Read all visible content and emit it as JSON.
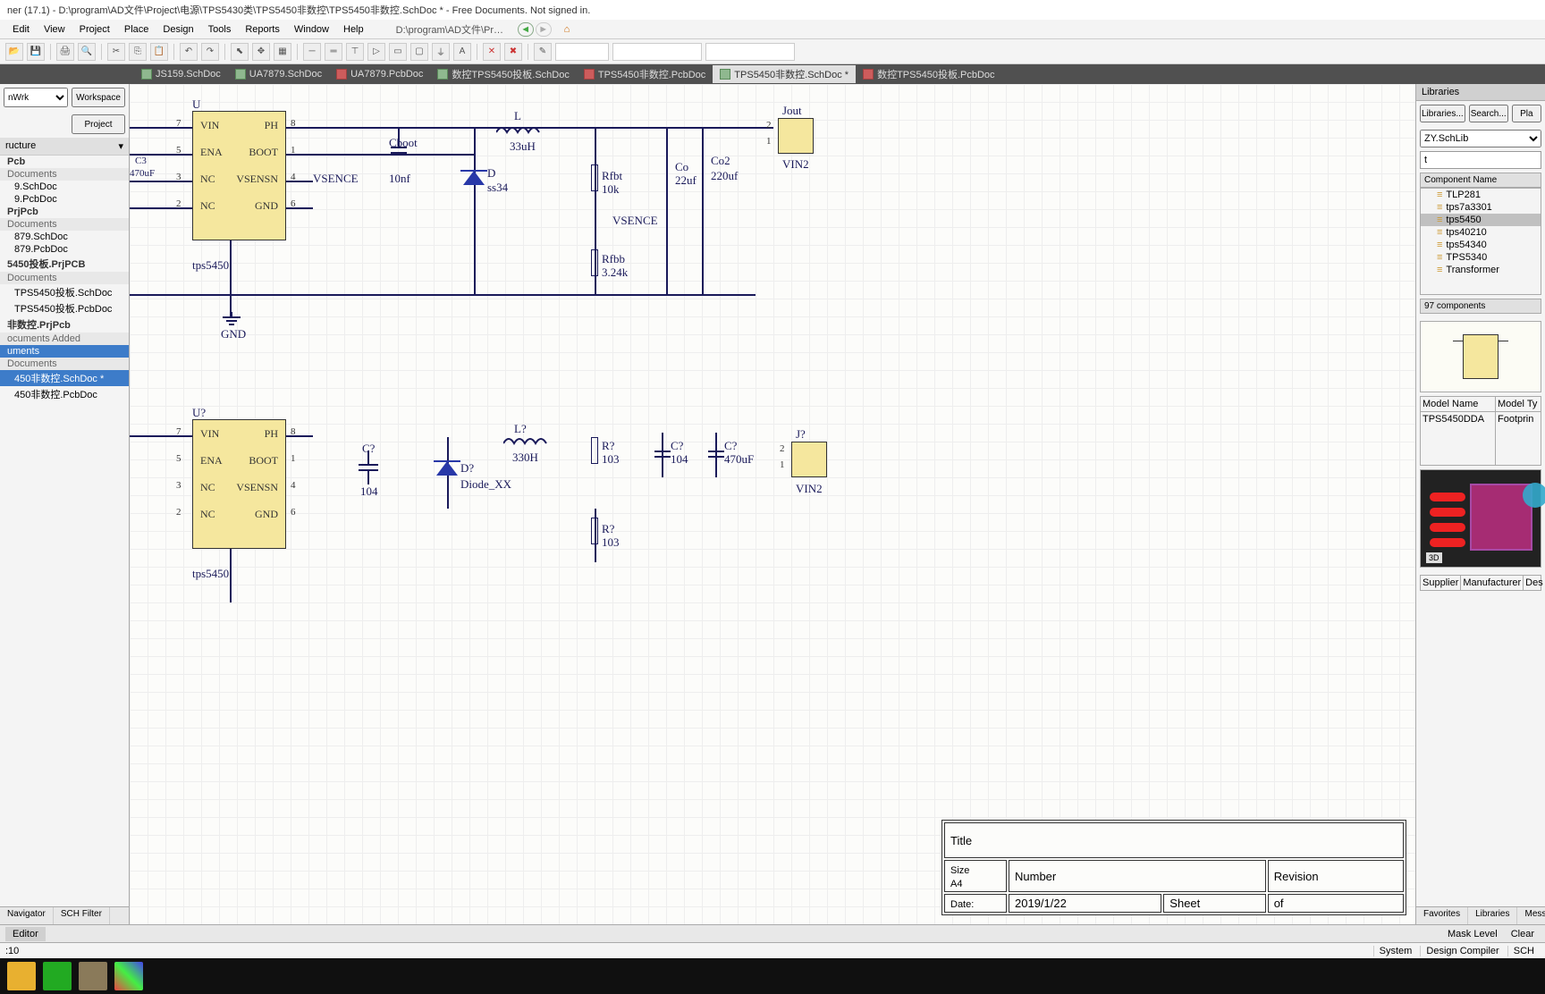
{
  "title": "ner (17.1) - D:\\program\\AD文件\\Project\\电源\\TPS5430类\\TPS5450非数控\\TPS5450非数控.SchDoc * - Free Documents. Not signed in.",
  "menu": [
    "Edit",
    "View",
    "Project",
    "Place",
    "Design",
    "Tools",
    "Reports",
    "Window",
    "Help"
  ],
  "addr": "D:\\program\\AD文件\\Project\\电…",
  "tabs": [
    {
      "name": "JS159.SchDoc",
      "type": "sch"
    },
    {
      "name": "UA7879.SchDoc",
      "type": "sch"
    },
    {
      "name": "UA7879.PcbDoc",
      "type": "pcb"
    },
    {
      "name": "数控TPS5450投板.SchDoc",
      "type": "sch"
    },
    {
      "name": "TPS5450非数控.PcbDoc",
      "type": "pcb"
    },
    {
      "name": "TPS5450非数控.SchDoc *",
      "type": "sch",
      "active": true
    },
    {
      "name": "数控TPS5450投板.PcbDoc",
      "type": "pcb"
    }
  ],
  "left": {
    "workspace_sel": "nWrk",
    "workspace_btn": "Workspace",
    "project_btn": "Project",
    "structure": "ructure",
    "tree": [
      {
        "t": "Pcb",
        "c": "proj"
      },
      {
        "t": "Documents",
        "c": "folder"
      },
      {
        "t": "9.SchDoc",
        "c": "file"
      },
      {
        "t": "9.PcbDoc",
        "c": "file"
      },
      {
        "t": "PrjPcb",
        "c": "proj"
      },
      {
        "t": "Documents",
        "c": "folder"
      },
      {
        "t": "879.SchDoc",
        "c": "file"
      },
      {
        "t": "879.PcbDoc",
        "c": "file"
      },
      {
        "t": "5450投板.PrjPCB",
        "c": "proj"
      },
      {
        "t": "Documents",
        "c": "folder"
      },
      {
        "t": "TPS5450投板.SchDoc",
        "c": "file"
      },
      {
        "t": "TPS5450投板.PcbDoc",
        "c": "file"
      },
      {
        "t": "非数控.PrjPcb",
        "c": "proj"
      },
      {
        "t": "ocuments Added",
        "c": "folder"
      },
      {
        "t": "uments",
        "c": "folder sel"
      },
      {
        "t": "Documents",
        "c": "folder"
      },
      {
        "t": "450非数控.SchDoc *",
        "c": "file sel"
      },
      {
        "t": "450非数控.PcbDoc",
        "c": "file"
      }
    ]
  },
  "sch": {
    "u_top": "U",
    "u_bot": "U?",
    "pins": [
      "VIN",
      "PH",
      "ENA",
      "BOOT",
      "NC",
      "VSENSN",
      "NC",
      "GND"
    ],
    "partname": "tps5450",
    "vsence": "VSENCE",
    "l_top": {
      "ref": "L",
      "val": "33uH"
    },
    "l_bot": {
      "ref": "L?",
      "val": "330H"
    },
    "cboot": {
      "ref": "Cboot",
      "val": "10nf"
    },
    "c_bot": {
      "ref": "C?",
      "val": "104"
    },
    "d_top": {
      "ref": "D",
      "val": "ss34"
    },
    "d_bot": {
      "ref": "D?",
      "val": "Diode_XX"
    },
    "rfbt": {
      "ref": "Rfbt",
      "val": "10k"
    },
    "rfbb": {
      "ref": "Rfbb",
      "val": "3.24k"
    },
    "r_bot1": {
      "ref": "R?",
      "val": "103"
    },
    "r_bot2": {
      "ref": "R?",
      "val": "103"
    },
    "co": {
      "ref": "Co",
      "val": "22uf"
    },
    "co2": {
      "ref": "Co2",
      "val": "220uf"
    },
    "c_bot2": {
      "ref": "C?",
      "val": "104"
    },
    "c_bot3": {
      "ref": "C?",
      "val": "470uF"
    },
    "c3": {
      "ref": "C3",
      "val": "470uF"
    },
    "jout": {
      "ref": "Jout",
      "val": "VIN2"
    },
    "j_bot": {
      "ref": "J?",
      "val": "VIN2"
    },
    "gnd": "GND",
    "title_block": {
      "title": "Title",
      "size": "Size",
      "size_v": "A4",
      "number": "Number",
      "rev": "Revision",
      "date": "Date:",
      "date_v": "2019/1/22",
      "sheet": "Sheet",
      "of": "of"
    }
  },
  "right": {
    "title": "Libraries",
    "btns": [
      "Libraries...",
      "Search...",
      "Pla"
    ],
    "lib": "ZY.SchLib",
    "filter": "t",
    "col": "Component Name",
    "comps": [
      "TLP281",
      "tps7a3301",
      "tps5450",
      "tps40210",
      "tps54340",
      "TPS5340",
      "Transformer"
    ],
    "comp_sel": 2,
    "count": "97 components",
    "model_col1": "Model Name",
    "model_col2": "Model Ty",
    "model_name": "TPS5450DDA",
    "model_type": "Footprin",
    "tabs_r": [
      "Supplier",
      "Manufacturer",
      "Des"
    ],
    "bottom": [
      "Favorites",
      "Libraries",
      "Messages"
    ],
    "sys": [
      "System",
      "Design Compiler",
      "SCH"
    ]
  },
  "bottom_left": [
    "Navigator",
    "SCH Filter"
  ],
  "editor": "Editor",
  "mask": [
    "Mask Level",
    "Clear"
  ],
  "status": ":10",
  "pin_nums_top": {
    "p7": "7",
    "p8": "8",
    "p5": "5",
    "p1": "1",
    "p3": "3",
    "p4": "4",
    "p2": "2",
    "p6": "6"
  }
}
